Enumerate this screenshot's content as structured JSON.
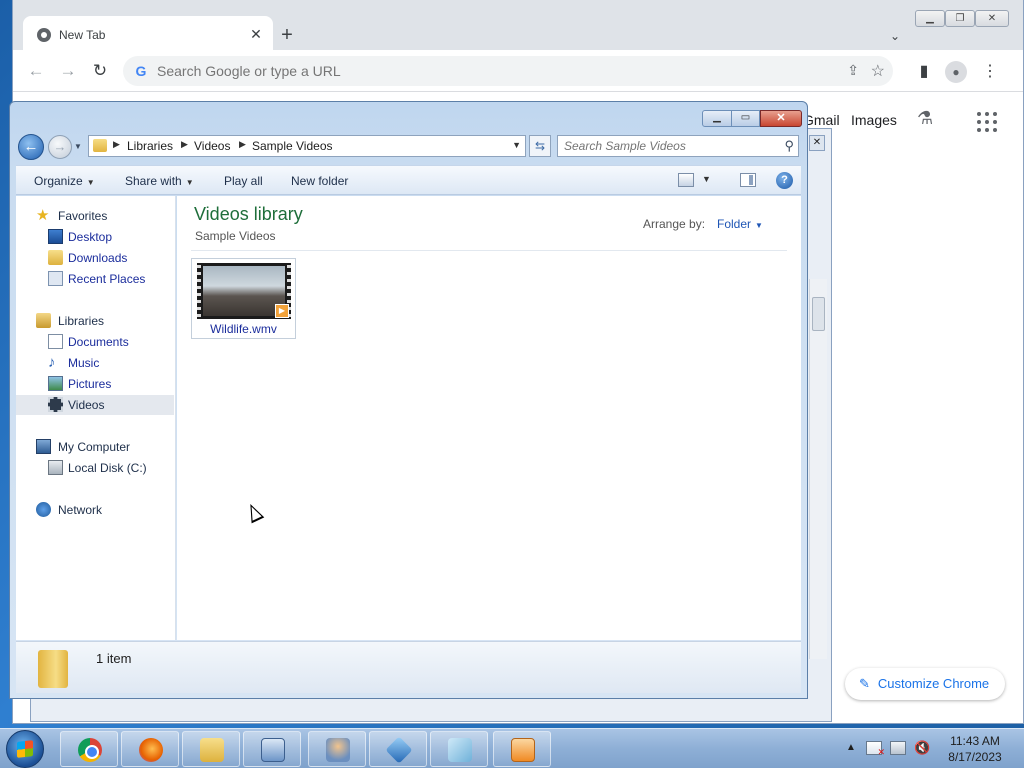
{
  "chrome": {
    "tab_title": "New Tab",
    "tab_close_glyph": "✕",
    "new_tab_glyph": "+",
    "omnibox_placeholder": "Search Google or type a URL",
    "page_links": [
      "Gmail",
      "Images"
    ],
    "customize_label": "Customize Chrome"
  },
  "explorer": {
    "breadcrumb": [
      "Libraries",
      "Videos",
      "Sample Videos"
    ],
    "search_placeholder": "Search Sample Videos",
    "toolbar": {
      "organize": "Organize",
      "share_with": "Share with",
      "play_all": "Play all",
      "new_folder": "New folder"
    },
    "nav": {
      "favorites": "Favorites",
      "desktop": "Desktop",
      "downloads": "Downloads",
      "recent_places": "Recent Places",
      "libraries": "Libraries",
      "documents": "Documents",
      "music": "Music",
      "pictures": "Pictures",
      "videos": "Videos",
      "my_computer": "My Computer",
      "local_disk": "Local Disk (C:)",
      "network": "Network"
    },
    "content": {
      "title": "Videos library",
      "subtitle": "Sample Videos",
      "arrange_label": "Arrange by:",
      "arrange_value": "Folder",
      "files": [
        {
          "name": "Wildlife.wmv",
          "icon": "video-thumbnail-icon"
        }
      ]
    },
    "details": {
      "count": "1 item"
    }
  },
  "taskbar": {
    "apps": [
      "chrome-icon",
      "firefox-icon",
      "file-explorer-icon",
      "control-panel-icon",
      "user-accounts-icon",
      "cube-app-icon",
      "notepad-icon",
      "media-player-icon"
    ],
    "clock": {
      "time": "11:43 AM",
      "date": "8/17/2023"
    }
  },
  "colors": {
    "library_title": "#1e6e3a",
    "link_blue": "#1b2d9c",
    "chrome_accent": "#1a73e8",
    "close_red": "#c84631"
  }
}
